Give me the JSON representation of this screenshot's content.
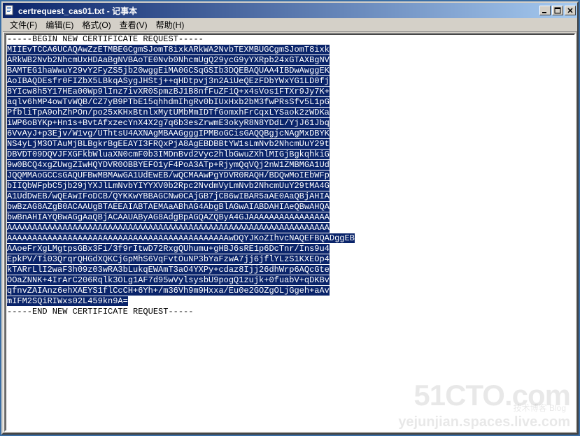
{
  "window": {
    "title": "certrequest_cas01.txt - 记事本"
  },
  "menubar": {
    "file": "文件(F)",
    "edit": "编辑(E)",
    "format": "格式(O)",
    "view": "查看(V)",
    "help": "帮助(H)"
  },
  "content": {
    "begin": "-----BEGIN NEW CERTIFICATE REQUEST-----",
    "end": "-----END NEW CERTIFICATE REQUEST-----",
    "body": [
      "MIIEvTCCA6UCAQAwZzETMBEGCgmSJomT8ixkARkWA2NvbTEXMBUGCgmSJomT8ixk",
      "ARkWB2Nvb2NhcmUxHDAaBgNVBAoTE0Nvb0NhcmUgQ29ycG9yYXRpb24xGTAXBgNV",
      "BAMTEG1haWwuY29vY2FyZS5jb20wggEiMA0GCSqGSIb3DQEBAQUAA4IBDwAwggEK",
      "AoIBAQDEsfr0FIZbX5LBkqASygJHStj++qHDtpvj3n2AiUeQEzFDbYWxYG1LD0fj",
      "8YIcw8h5Y17HEa00Wp9lInz7ivXR0SpmzBJ1B8nfFuZF1Q+x4sVos1FTXr9Jy7K+",
      "aqlv6hMP4owTvWQB/CZ7yB9PTbE15qhhdmIhgRv0bIUxHxb2bM3fwPRsSfv5L1pG",
      "PfbliTpA9ohZhPOn/po25xKHxBtnlxMytUMbMmIDTfGomxhFrCqxLYSaok2zWDKa",
      "iWP6oBYKp+Hn1s+BvtAfxzecYnX4X2g7q6b3esZrwmE3okyR8N8YDdL/YjJ61Jbq",
      "6VvAyJ+p3Ejv/W1vg/UThtsU4AXNAgMBAAGgggIPMBoGCisGAQQBgjcNAgMxDBYK",
      "NS4yLjM3OTAuMjBLBgkrBgEEAYI3FRQxPjA8AgEBDBBtYW1sLmNvb2NhcmUuY29t",
      "DBVDT09DQVJFXGFkbWluaXN0cmF0b3IMDnBvd2Vyc2hlbGwuZXhlMIGjBgkqhkiG",
      "9w0BCQ4xgZUwgZIwHQYDVR0OBBYEFO1yF4PoA3ATp+RjymQqVQj2nW1ZMBMGA1Ud",
      "JQQMMAoGCCsGAQUFBwMBMAwGA1UdEwEB/wQCMAAwPgYDVR0RAQH/BDQwMoIEbWFp",
      "bIIQbWFpbC5jb29jYXJlLmNvbYIYYXV0b2Rpc2NvdmVyLmNvb2NhcmUuY29tMA4G",
      "A1UdDwEB/wQEAwIFoDCB/QYKKwYBBAGCNw0CAjGB7jCB6wIBAR5aAE0AaQBjAHIA",
      "bwBzAG8AZgB0ACAAUgBTAEEAIABTAEMAaABhAG4AbgBlAGwAIABDAHIAeQBwAHQA",
      "bwBnAHIAYQBwAGgAaQBjACAAUAByAG8AdgBpAGQAZQByA4GJAAAAAAAAAAAAAAAA",
      "AAAAAAAAAAAAAAAAAAAAAAAAAAAAAAAAAAAAAAAAAAAAAAAAAAAAAAAAAAAAAAAA",
      "AAAAAAAAAAAAAAAAAAAAAAAAAAAAAAAAAAAAAAAAAAAAwDQYJKoZIhvcNAQEFBQADggEB",
      "AAoeFrXgLMgtpsGBx3Fi/3f9rItwD72RxgQUhumu+gHBJ6sRE1p6DcTnr/Ins9u4",
      "EpkPV/Ti03QrqrQHGdXQKCjGpMhS6VqFvtOuNP3bYaFzwA7jj6jflYLzS1KXEOp4",
      "kTARrLlI2waF3h09z03wRA3bLukqEWAmT3aO4YXPy+cdaz8Ijj26dhWrp6AQcGte",
      "OOaZNNK+4IrArC206Rqlk3OLg1AF7d95wVylsysbU9pogQ1zujk+0fuabV+qDKBv",
      "qfnvZAIAnz6ehXAEYS1flCcCH+6Yh+/m36Vh9m9Hxxa/Eu0e2GOZgOLjGgeh+aAv",
      "mIFM2SQiRIWxs02L459kn9A="
    ]
  },
  "watermark": {
    "main": "51CTO.com",
    "sub": "技术博客  Blog",
    "url": "yejunjian.spaces.live.com"
  }
}
